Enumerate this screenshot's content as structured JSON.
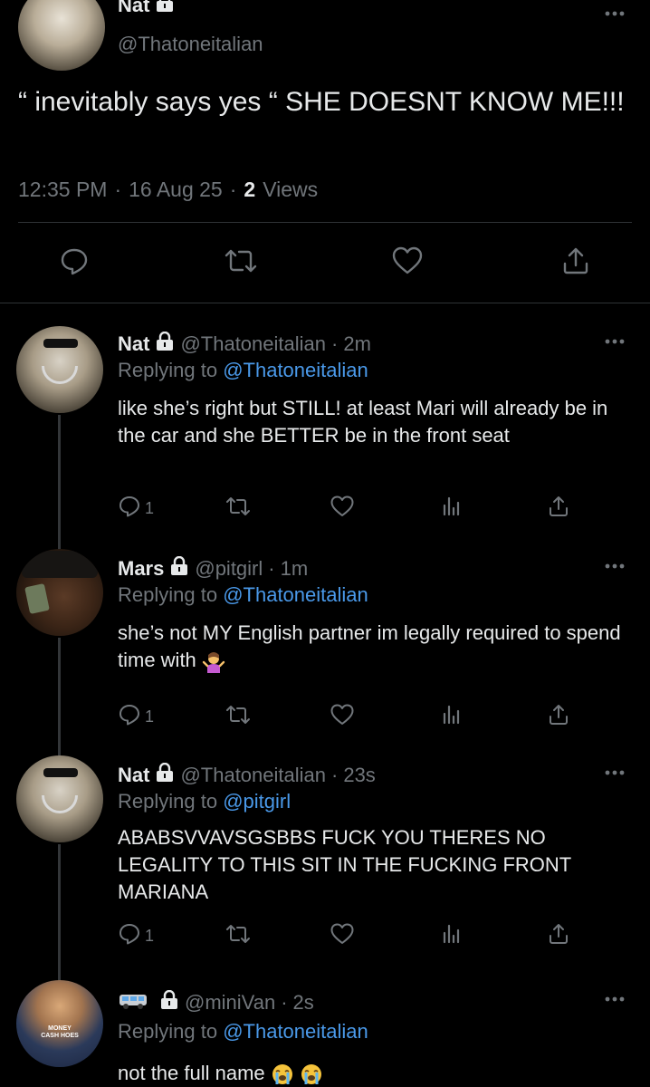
{
  "main": {
    "name": "Nat",
    "handle": "@Thatoneitalian",
    "text": "“ inevitably says yes “ SHE DOESNT KNOW ME!!!",
    "time": "12:35 PM",
    "date": "16 Aug 25",
    "views_count": "2",
    "views_label": "Views",
    "sep": "·"
  },
  "replies": [
    {
      "name": "Nat",
      "handle": "@Thatoneitalian",
      "age": "2m",
      "replying_prefix": "Replying to",
      "replying_to": "@Thatoneitalian",
      "text": "like she’s right but STILL! at least Mari will already be in the car and she BETTER be in the front seat",
      "reply_count": "1"
    },
    {
      "name": "Mars",
      "handle": "@pitgirl",
      "age": "1m",
      "replying_prefix": "Replying to",
      "replying_to": "@Thatoneitalian",
      "text": "she’s not MY English partner im legally required to spend time with",
      "reply_count": "1"
    },
    {
      "name": "Nat",
      "handle": "@Thatoneitalian",
      "age": "23s",
      "replying_prefix": "Replying to",
      "replying_to": "@pitgirl",
      "text": "ABABSVVAVSGSBBS FUCK YOU THERES NO LEGALITY TO THIS SIT IN THE FUCKING FRONT MARIANA",
      "reply_count": "1"
    },
    {
      "name": "",
      "handle": "@miniVan",
      "age": "2s",
      "replying_prefix": "Replying to",
      "replying_to": "@Thatoneitalian",
      "text": "not the full name"
    }
  ],
  "avatar5_shirt_text": "MONEY CASH HOES",
  "icons": [
    "lock-icon",
    "more-icon",
    "reply-icon",
    "retweet-icon",
    "like-icon",
    "share-icon",
    "views-icon",
    "van-emoji",
    "loudly-crying-emoji",
    "woman-shrugging-emoji"
  ],
  "colors": {
    "background": "#000000",
    "text": "#e7e9ea",
    "muted": "#71767b",
    "link": "#4a99e9",
    "divider": "#2f3336"
  }
}
